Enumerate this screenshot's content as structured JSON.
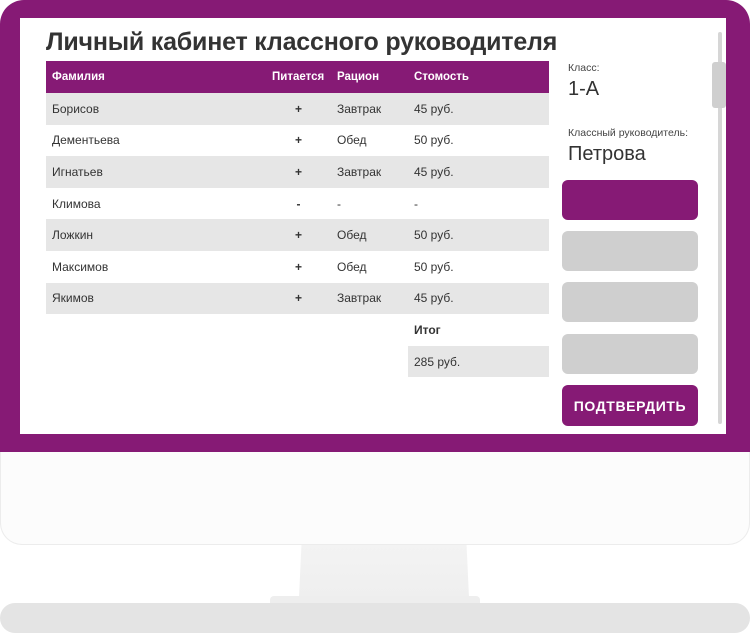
{
  "page": {
    "title": "Личный кабинет классного руководителя"
  },
  "table": {
    "headers": [
      "Фамилия",
      "Питается",
      "Рацион",
      "Стомость"
    ],
    "rows": [
      {
        "surname": "Борисов",
        "eats": "+",
        "ration": "Завтрак",
        "cost": "45 руб."
      },
      {
        "surname": "Дементьева",
        "eats": "+",
        "ration": "Обед",
        "cost": "50 руб."
      },
      {
        "surname": "Игнатьев",
        "eats": "+",
        "ration": "Завтрак",
        "cost": "45 руб."
      },
      {
        "surname": "Климова",
        "eats": "-",
        "ration": "-",
        "cost": "-"
      },
      {
        "surname": "Ложкин",
        "eats": "+",
        "ration": "Обед",
        "cost": "50 руб."
      },
      {
        "surname": "Максимов",
        "eats": "+",
        "ration": "Обед",
        "cost": "50 руб."
      },
      {
        "surname": "Якимов",
        "eats": "+",
        "ration": "Завтрак",
        "cost": "45 руб."
      }
    ],
    "total_label": "Итог",
    "total_value": "285 руб."
  },
  "sidebar": {
    "class_label": "Класс:",
    "class_value": "1-А",
    "teacher_label": "Классный руководитель:",
    "teacher_value": "Петрова",
    "confirm_label": "ПОДТВЕРДИТЬ"
  },
  "colors": {
    "accent": "#861a75",
    "row_alt": "#e6e6e6",
    "slot_inactive": "#cfcfcf"
  }
}
